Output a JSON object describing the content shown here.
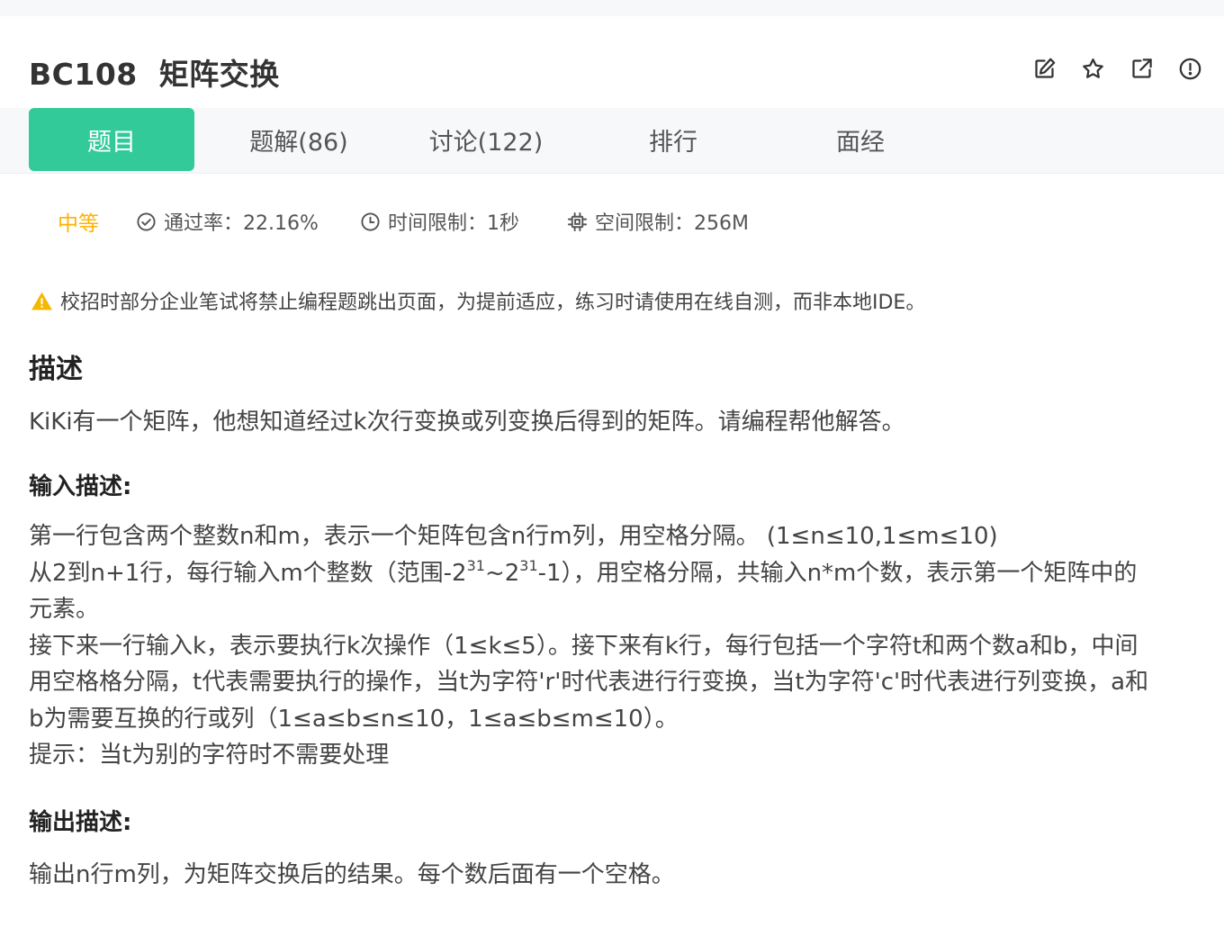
{
  "header": {
    "title": "BC108  矩阵交换",
    "actions": [
      {
        "name": "edit-button",
        "icon": "edit-icon"
      },
      {
        "name": "favorite-button",
        "icon": "star-icon"
      },
      {
        "name": "share-button",
        "icon": "external-link-icon"
      },
      {
        "name": "report-button",
        "icon": "alert-circle-icon"
      }
    ]
  },
  "tabs": [
    {
      "label": "题目",
      "active": true
    },
    {
      "label": "题解(86)",
      "active": false
    },
    {
      "label": "讨论(122)",
      "active": false
    },
    {
      "label": "排行",
      "active": false
    },
    {
      "label": "面经",
      "active": false
    }
  ],
  "meta": {
    "difficulty": "中等",
    "pass_rate": "通过率：22.16%",
    "time_limit": "时间限制：1秒",
    "memory_limit": "空间限制：256M"
  },
  "notice": "校招时部分企业笔试将禁止编程题跳出页面，为提前适应，练习时请使用在线自测，而非本地IDE。",
  "description": {
    "heading": "描述",
    "text": "KiKi有一个矩阵，他想知道经过k次行变换或列变换后得到的矩阵。请编程帮他解答。"
  },
  "input": {
    "heading": "输入描述:",
    "line1": "第一行包含两个整数n和m，表示一个矩阵包含n行m列，用空格分隔。 (1≤n≤10,1≤m≤10)",
    "line2_a": "从2到n+1行，每行输入m个整数（范围-2",
    "line2_sup1": "31",
    "line2_b": "~2",
    "line2_sup2": "31",
    "line2_c": "-1），用空格分隔，共输入n*m个数，表示第一个矩阵中的",
    "line3": "元素。",
    "line4": "接下来一行输入k，表示要执行k次操作（1≤k≤5）。接下来有k行，每行包括一个字符t和两个数a和b，中间",
    "line5": "用空格格分隔，t代表需要执行的操作，当t为字符'r'时代表进行行变换，当t为字符'c'时代表进行列变换，a和",
    "line6": "b为需要互换的行或列（1≤a≤b≤n≤10，1≤a≤b≤m≤10）。",
    "line7": "提示：当t为别的字符时不需要处理"
  },
  "output": {
    "heading": "输出描述:",
    "text": "输出n行m列，为矩阵交换后的结果。每个数后面有一个空格。"
  },
  "colors": {
    "accent": "#32ca99",
    "difficulty": "#ffb300",
    "warning": "#f5b800"
  }
}
